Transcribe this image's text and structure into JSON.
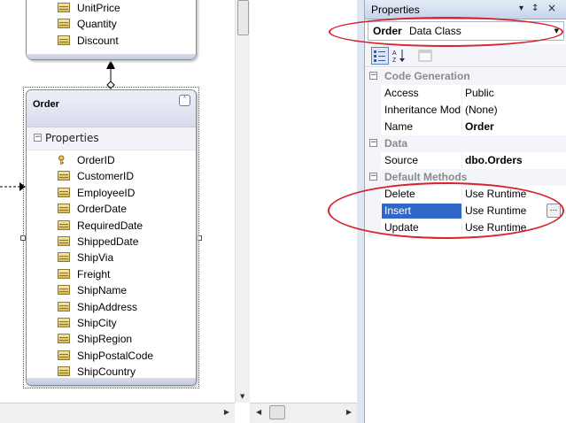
{
  "designer": {
    "top_entity": {
      "properties": [
        "UnitPrice",
        "Quantity",
        "Discount"
      ]
    },
    "order_entity": {
      "title": "Order",
      "collapse_glyph": "˄",
      "section_label": "Properties",
      "properties": [
        {
          "name": "OrderID",
          "icon": "key-icon"
        },
        {
          "name": "CustomerID",
          "icon": "column-icon"
        },
        {
          "name": "EmployeeID",
          "icon": "column-icon"
        },
        {
          "name": "OrderDate",
          "icon": "column-icon"
        },
        {
          "name": "RequiredDate",
          "icon": "column-icon"
        },
        {
          "name": "ShippedDate",
          "icon": "column-icon"
        },
        {
          "name": "ShipVia",
          "icon": "column-icon"
        },
        {
          "name": "Freight",
          "icon": "column-icon"
        },
        {
          "name": "ShipName",
          "icon": "column-icon"
        },
        {
          "name": "ShipAddress",
          "icon": "column-icon"
        },
        {
          "name": "ShipCity",
          "icon": "column-icon"
        },
        {
          "name": "ShipRegion",
          "icon": "column-icon"
        },
        {
          "name": "ShipPostalCode",
          "icon": "column-icon"
        },
        {
          "name": "ShipCountry",
          "icon": "column-icon"
        }
      ]
    }
  },
  "properties_window": {
    "title": "Properties",
    "titlebar_buttons": [
      "▾",
      "↕",
      "×"
    ],
    "selected_object": {
      "name": "Order",
      "type": "Data Class"
    },
    "categories": [
      {
        "label": "Code Generation",
        "rows": [
          {
            "name": "Access",
            "value": "Public",
            "bold": false
          },
          {
            "name": "Inheritance Modifier",
            "value": "(None)",
            "bold": false
          },
          {
            "name": "Name",
            "value": "Order",
            "bold": true
          }
        ]
      },
      {
        "label": "Data",
        "rows": [
          {
            "name": "Source",
            "value": "dbo.Orders",
            "bold": true
          }
        ]
      },
      {
        "label": "Default Methods",
        "rows": [
          {
            "name": "Delete",
            "value": "Use Runtime",
            "bold": false
          },
          {
            "name": "Insert",
            "value": "Use Runtime",
            "bold": false,
            "selected": true
          },
          {
            "name": "Update",
            "value": "Use Runtime",
            "bold": false
          }
        ]
      }
    ],
    "ellipsis_label": "..."
  },
  "colors": {
    "annotation": "#d8232a",
    "selection": "#3168c8",
    "category_text": "#8a8a8a"
  }
}
